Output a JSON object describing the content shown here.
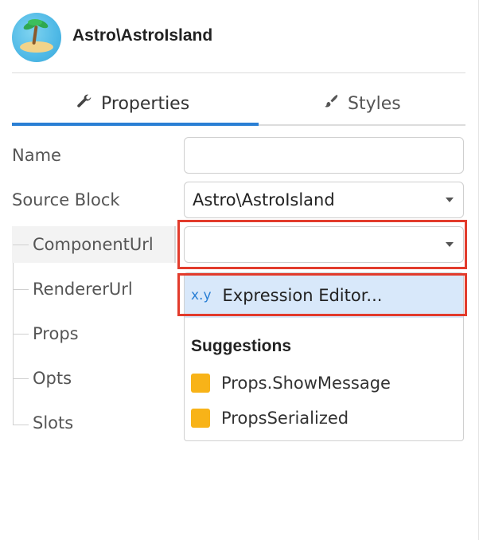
{
  "header": {
    "title": "Astro\\AstroIsland"
  },
  "tabs": [
    {
      "label": "Properties",
      "icon": "wrench-icon",
      "active": true
    },
    {
      "label": "Styles",
      "icon": "paintbrush-icon",
      "active": false
    }
  ],
  "form": {
    "name_label": "Name",
    "name_value": "",
    "source_block_label": "Source Block",
    "source_block_value": "Astro\\AstroIsland",
    "children": [
      {
        "label": "ComponentUrl",
        "value": ""
      },
      {
        "label": "RendererUrl"
      },
      {
        "label": "Props"
      },
      {
        "label": "Opts"
      },
      {
        "label": "Slots"
      }
    ]
  },
  "dropdown": {
    "expression_prefix": "x.y",
    "expression_label": "Expression Editor...",
    "suggestions_heading": "Suggestions",
    "suggestions": [
      {
        "label": "Props.ShowMessage",
        "color": "#f8b318"
      },
      {
        "label": "PropsSerialized",
        "color": "#f8b318"
      }
    ]
  },
  "colors": {
    "accent": "#2a7fd4",
    "highlight": "#e23b2c",
    "selected_bg": "#d8e8fa"
  }
}
